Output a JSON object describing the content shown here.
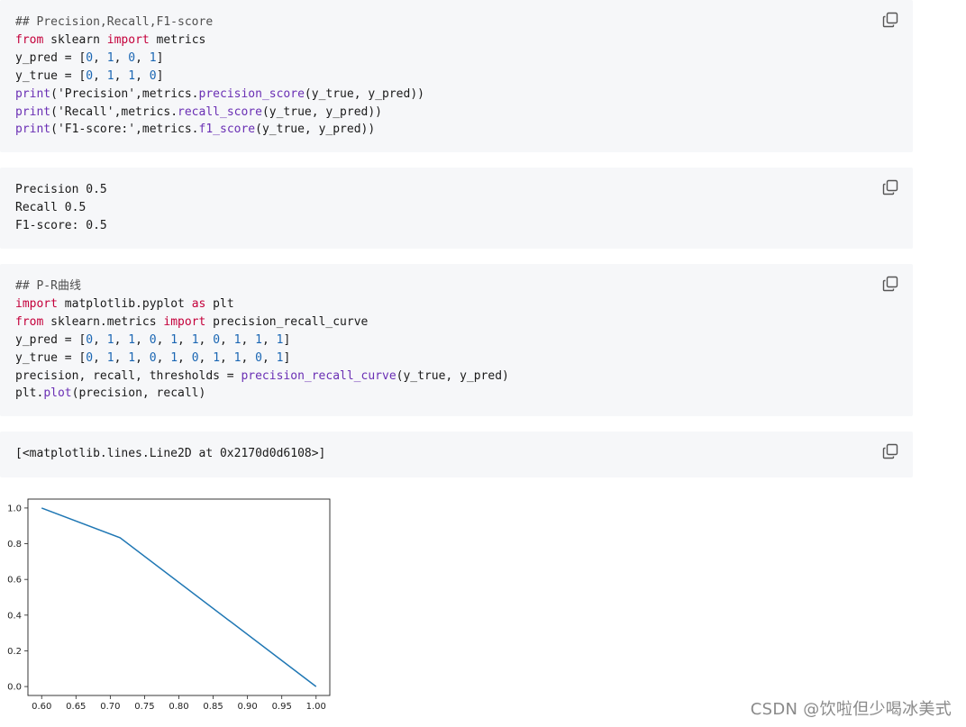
{
  "cells": {
    "block1": {
      "lines": [
        [
          {
            "t": "## Precision,Recall,F1-score",
            "c": "comment"
          }
        ],
        [
          {
            "t": "from",
            "c": "kw"
          },
          {
            "t": " sklearn ",
            "c": ""
          },
          {
            "t": "import",
            "c": "kw"
          },
          {
            "t": " metrics",
            "c": ""
          }
        ],
        [
          {
            "t": "y_pred = [",
            "c": ""
          },
          {
            "t": "0",
            "c": "num"
          },
          {
            "t": ", ",
            "c": ""
          },
          {
            "t": "1",
            "c": "num"
          },
          {
            "t": ", ",
            "c": ""
          },
          {
            "t": "0",
            "c": "num"
          },
          {
            "t": ", ",
            "c": ""
          },
          {
            "t": "1",
            "c": "num"
          },
          {
            "t": "]",
            "c": ""
          }
        ],
        [
          {
            "t": "y_true = [",
            "c": ""
          },
          {
            "t": "0",
            "c": "num"
          },
          {
            "t": ", ",
            "c": ""
          },
          {
            "t": "1",
            "c": "num"
          },
          {
            "t": ", ",
            "c": ""
          },
          {
            "t": "1",
            "c": "num"
          },
          {
            "t": ", ",
            "c": ""
          },
          {
            "t": "0",
            "c": "num"
          },
          {
            "t": "]",
            "c": ""
          }
        ],
        [
          {
            "t": "print",
            "c": "fn"
          },
          {
            "t": "('Precision',metrics.",
            "c": ""
          },
          {
            "t": "precision_score",
            "c": "fn"
          },
          {
            "t": "(y_true, y_pred))",
            "c": ""
          }
        ],
        [
          {
            "t": "print",
            "c": "fn"
          },
          {
            "t": "('Recall',metrics.",
            "c": ""
          },
          {
            "t": "recall_score",
            "c": "fn"
          },
          {
            "t": "(y_true, y_pred))",
            "c": ""
          }
        ],
        [
          {
            "t": "print",
            "c": "fn"
          },
          {
            "t": "('F1-score:',metrics.",
            "c": ""
          },
          {
            "t": "f1_score",
            "c": "fn"
          },
          {
            "t": "(y_true, y_pred))",
            "c": ""
          }
        ]
      ]
    },
    "block2": {
      "lines": [
        [
          {
            "t": "Precision 0.5",
            "c": ""
          }
        ],
        [
          {
            "t": "Recall 0.5",
            "c": ""
          }
        ],
        [
          {
            "t": "F1-score: 0.5",
            "c": ""
          }
        ]
      ]
    },
    "block3": {
      "lines": [
        [
          {
            "t": "## P-R曲线",
            "c": "comment"
          }
        ],
        [
          {
            "t": "import",
            "c": "kw"
          },
          {
            "t": " matplotlib.pyplot ",
            "c": ""
          },
          {
            "t": "as",
            "c": "kw"
          },
          {
            "t": " plt",
            "c": ""
          }
        ],
        [
          {
            "t": "from",
            "c": "kw"
          },
          {
            "t": " sklearn.metrics ",
            "c": ""
          },
          {
            "t": "import",
            "c": "kw"
          },
          {
            "t": " precision_recall_curve",
            "c": ""
          }
        ],
        [
          {
            "t": "y_pred = [",
            "c": ""
          },
          {
            "t": "0",
            "c": "num"
          },
          {
            "t": ", ",
            "c": ""
          },
          {
            "t": "1",
            "c": "num"
          },
          {
            "t": ", ",
            "c": ""
          },
          {
            "t": "1",
            "c": "num"
          },
          {
            "t": ", ",
            "c": ""
          },
          {
            "t": "0",
            "c": "num"
          },
          {
            "t": ", ",
            "c": ""
          },
          {
            "t": "1",
            "c": "num"
          },
          {
            "t": ", ",
            "c": ""
          },
          {
            "t": "1",
            "c": "num"
          },
          {
            "t": ", ",
            "c": ""
          },
          {
            "t": "0",
            "c": "num"
          },
          {
            "t": ", ",
            "c": ""
          },
          {
            "t": "1",
            "c": "num"
          },
          {
            "t": ", ",
            "c": ""
          },
          {
            "t": "1",
            "c": "num"
          },
          {
            "t": ", ",
            "c": ""
          },
          {
            "t": "1",
            "c": "num"
          },
          {
            "t": "]",
            "c": ""
          }
        ],
        [
          {
            "t": "y_true = [",
            "c": ""
          },
          {
            "t": "0",
            "c": "num"
          },
          {
            "t": ", ",
            "c": ""
          },
          {
            "t": "1",
            "c": "num"
          },
          {
            "t": ", ",
            "c": ""
          },
          {
            "t": "1",
            "c": "num"
          },
          {
            "t": ", ",
            "c": ""
          },
          {
            "t": "0",
            "c": "num"
          },
          {
            "t": ", ",
            "c": ""
          },
          {
            "t": "1",
            "c": "num"
          },
          {
            "t": ", ",
            "c": ""
          },
          {
            "t": "0",
            "c": "num"
          },
          {
            "t": ", ",
            "c": ""
          },
          {
            "t": "1",
            "c": "num"
          },
          {
            "t": ", ",
            "c": ""
          },
          {
            "t": "1",
            "c": "num"
          },
          {
            "t": ", ",
            "c": ""
          },
          {
            "t": "0",
            "c": "num"
          },
          {
            "t": ", ",
            "c": ""
          },
          {
            "t": "1",
            "c": "num"
          },
          {
            "t": "]",
            "c": ""
          }
        ],
        [
          {
            "t": "precision, recall, thresholds = ",
            "c": ""
          },
          {
            "t": "precision_recall_curve",
            "c": "fn"
          },
          {
            "t": "(y_true, y_pred)",
            "c": ""
          }
        ],
        [
          {
            "t": "plt.",
            "c": ""
          },
          {
            "t": "plot",
            "c": "fn"
          },
          {
            "t": "(precision, recall)",
            "c": ""
          }
        ]
      ]
    },
    "block4": {
      "lines": [
        [
          {
            "t": "[<matplotlib.lines.Line2D at 0x2170d0d6108>]",
            "c": ""
          }
        ]
      ]
    }
  },
  "copy_icon": "copy-icon",
  "colors": {
    "code_bg": "#f6f7f9",
    "keyword": "#c4003b",
    "function": "#6a2fb4",
    "number": "#1a66b3",
    "line": "#1f77b4"
  },
  "chart_data": {
    "type": "line",
    "x": [
      0.6,
      0.7142857,
      1.0
    ],
    "y": [
      1.0,
      0.8333333,
      0.0
    ],
    "xlim": [
      0.58,
      1.02
    ],
    "ylim": [
      -0.05,
      1.05
    ],
    "xticks": [
      0.6,
      0.65,
      0.7,
      0.75,
      0.8,
      0.85,
      0.9,
      0.95,
      1.0
    ],
    "xtick_labels": [
      "0.60",
      "0.65",
      "0.70",
      "0.75",
      "0.80",
      "0.85",
      "0.90",
      "0.95",
      "1.00"
    ],
    "yticks": [
      0.0,
      0.2,
      0.4,
      0.6,
      0.8,
      1.0
    ],
    "ytick_labels": [
      "0.0",
      "0.2",
      "0.4",
      "0.6",
      "0.8",
      "1.0"
    ],
    "grid": false
  },
  "watermark": "CSDN @饮啦但少喝冰美式"
}
